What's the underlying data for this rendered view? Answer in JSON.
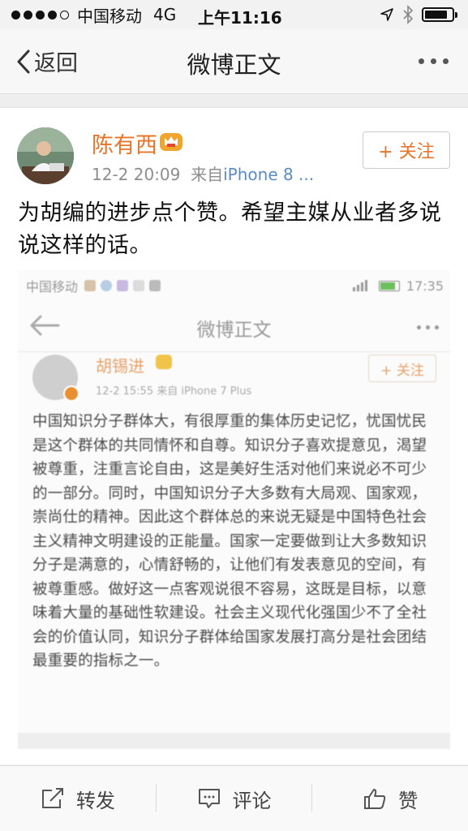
{
  "status_bar": {
    "carrier": "中国移动",
    "network": "4G",
    "time": "上午11:16",
    "battery_level": 0.85
  },
  "nav": {
    "back_label": "返回",
    "title": "微博正文"
  },
  "post": {
    "author": "陈有西",
    "timestamp": "12-2 20:09",
    "source_prefix": "来自",
    "source": "iPhone 8 ...",
    "follow_label": "+ 关注",
    "text": "为胡编的进步点个赞。希望主媒从业者多说说这样的话。"
  },
  "embedded_screenshot": {
    "status": {
      "carrier": "中国移动",
      "time": "17:35"
    },
    "title": "微博正文",
    "author": "胡锡进",
    "meta": "12-2 15:55  来自 iPhone 7 Plus",
    "follow_label": "+ 关注",
    "text": "中国知识分子群体大，有很厚重的集体历史记忆，忧国忧民是这个群体的共同情怀和自尊。知识分子喜欢提意见，渴望被尊重，注重言论自由，这是美好生活对他们来说必不可少的一部分。同时，中国知识分子大多数有大局观、国家观，崇尚仕的精神。因此这个群体总的来说无疑是中国特色社会主义精神文明建设的正能量。国家一定要做到让大多数知识分子是满意的，心情舒畅的，让他们有发表意见的空间，有被尊重感。做好这一点客观说很不容易，这既是目标，以意味着大量的基础性软建设。社会主义现代化强国少不了全社会的价值认同，知识分子群体给国家发展打高分是社会团结最重要的指标之一。"
  },
  "tabbar": {
    "repost": "转发",
    "comment": "评论",
    "like": "赞"
  },
  "colors": {
    "accent": "#e8742a",
    "link": "#5b8bc7"
  }
}
